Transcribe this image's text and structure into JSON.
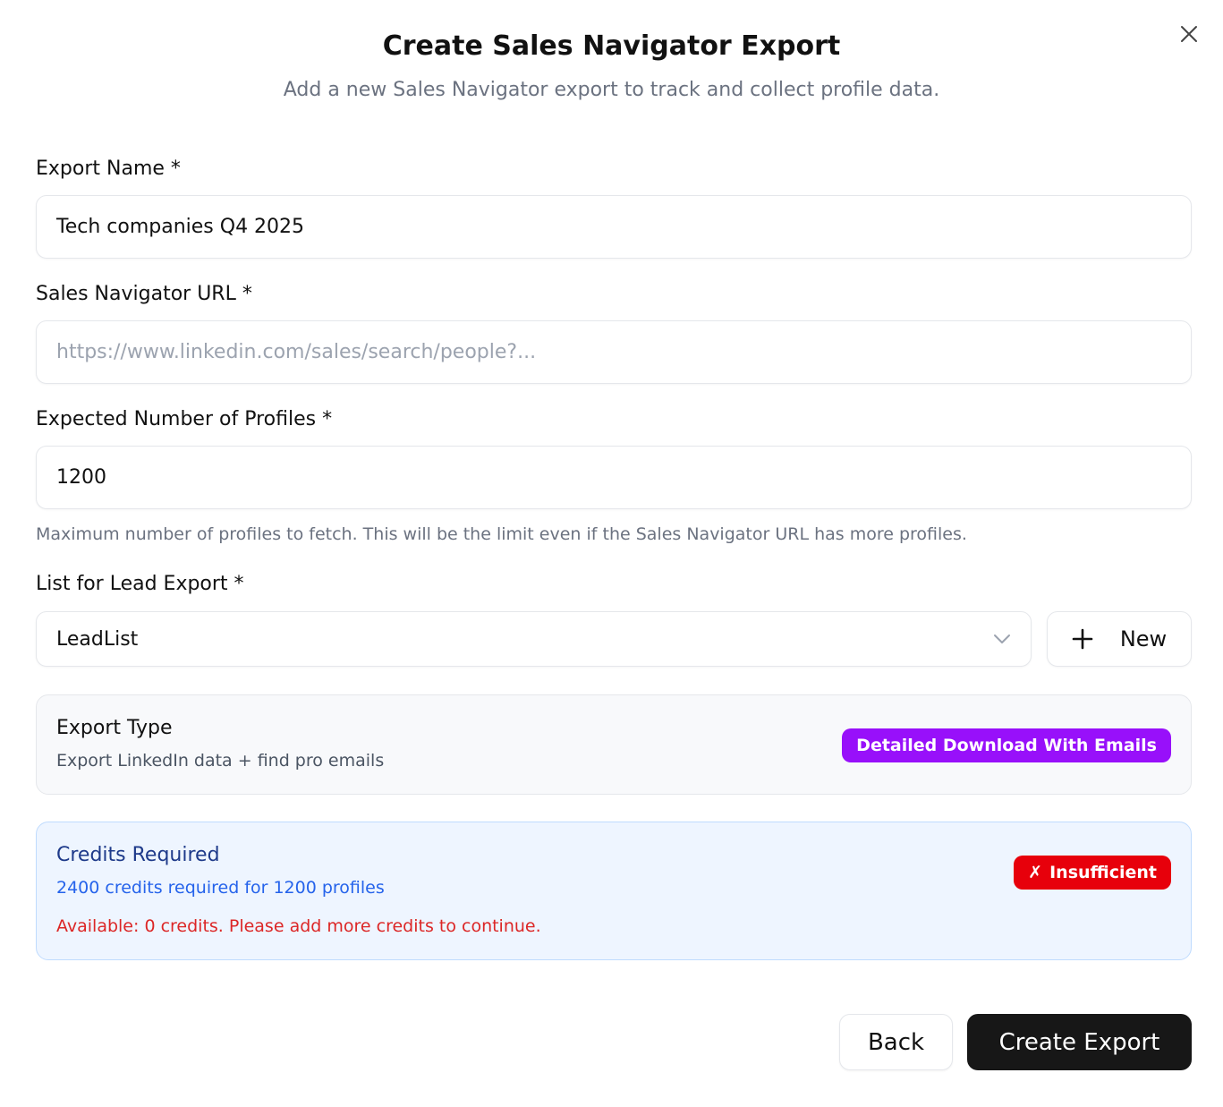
{
  "dialog": {
    "title": "Create Sales Navigator Export",
    "subtitle": "Add a new Sales Navigator export to track and collect profile data.",
    "close_icon": "close-icon"
  },
  "form": {
    "export_name": {
      "label": "Export Name *",
      "value": "Tech companies Q4 2025"
    },
    "sales_nav_url": {
      "label": "Sales Navigator URL *",
      "placeholder": "https://www.linkedin.com/sales/search/people?..."
    },
    "expected_profiles": {
      "label": "Expected Number of Profiles *",
      "value": "1200",
      "hint": "Maximum number of profiles to fetch. This will be the limit even if the Sales Navigator URL has more profiles."
    },
    "lead_list": {
      "label": "List for Lead Export *",
      "selected": "LeadList",
      "new_button": "New"
    }
  },
  "export_type": {
    "title": "Export Type",
    "description": "Export LinkedIn data + find pro emails",
    "badge": "Detailed Download With Emails",
    "badge_color": "#9810fa"
  },
  "credits": {
    "title": "Credits Required",
    "required_text": "2400 credits required for 1200 profiles",
    "warning_text": "Available: 0 credits. Please add more credits to continue.",
    "badge_glyph": "✗",
    "badge": "Insufficient",
    "badge_color": "#e7000b"
  },
  "actions": {
    "back": "Back",
    "create": "Create Export"
  }
}
